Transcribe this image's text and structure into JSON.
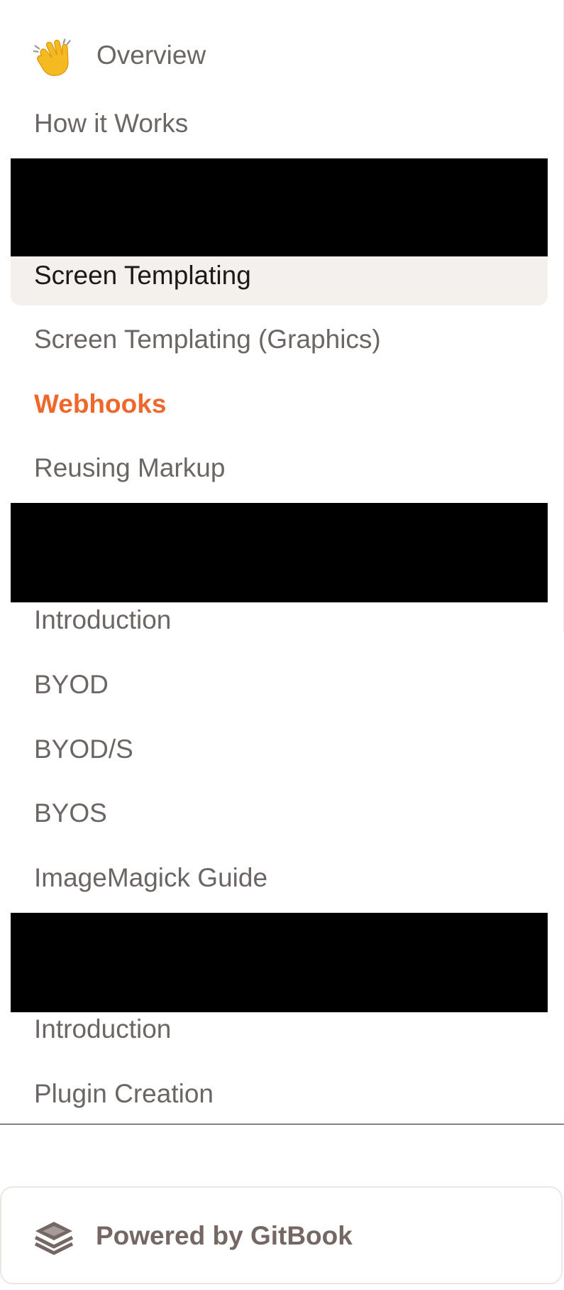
{
  "nav": {
    "overview": {
      "label": "Overview",
      "icon": "waving-hand-icon"
    },
    "how_it_works": "How it Works",
    "screen_templating": "Screen Templating",
    "screen_templating_graphics": "Screen Templating (Graphics)",
    "webhooks": "Webhooks",
    "reusing_markup": "Reusing Markup",
    "introduction_1": "Introduction",
    "byod": "BYOD",
    "byods": "BYOD/S",
    "byos": "BYOS",
    "imagemagick_guide": "ImageMagick Guide",
    "introduction_2": "Introduction",
    "plugin_creation": "Plugin Creation"
  },
  "footer": {
    "powered_by": "Powered by GitBook",
    "icon": "gitbook-icon"
  },
  "colors": {
    "active_link": "#f0672b",
    "active_bg": "#f4f0ee",
    "text": "#6b6664",
    "current_text": "#1c1a19"
  }
}
